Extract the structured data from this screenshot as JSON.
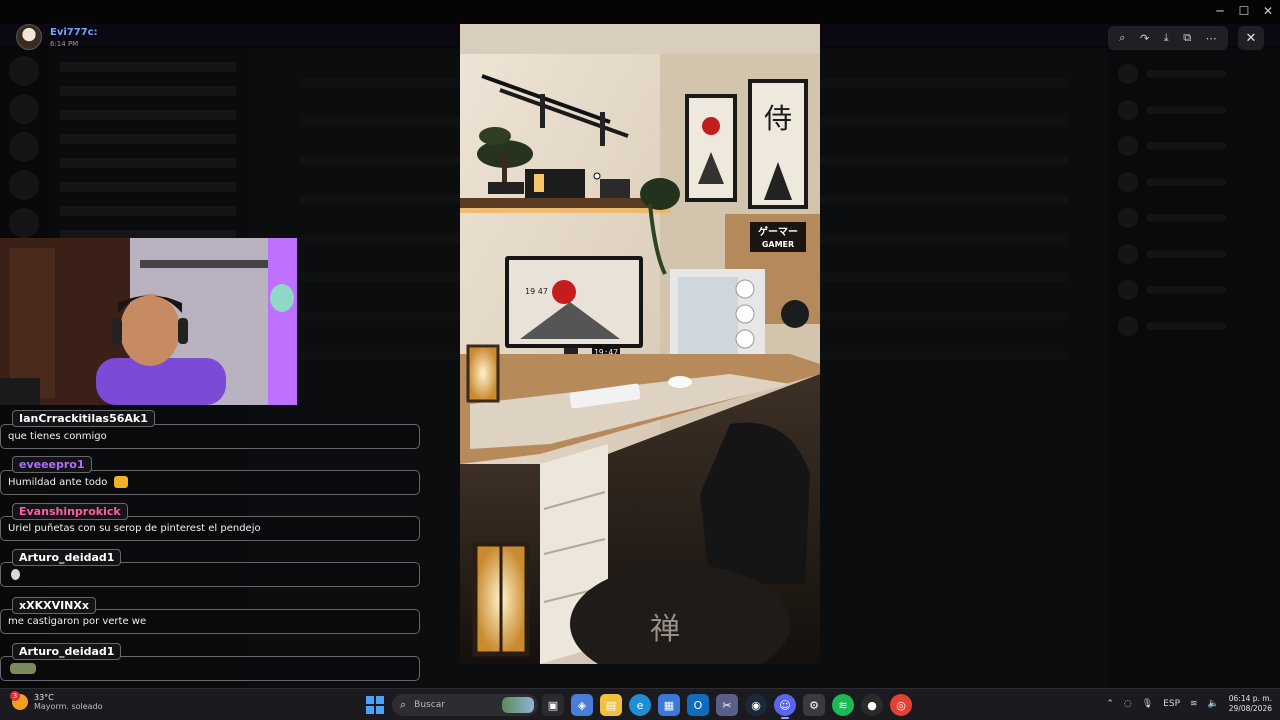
{
  "viewer": {
    "username": "Evi777c:",
    "time": "6:14 PM"
  },
  "chat": {
    "messages": [
      {
        "user": "IanCrrackitilas56Ak1",
        "user_color": "#ffffff",
        "text": "que tienes conmigo",
        "emoji": ""
      },
      {
        "user": "eveeepro1",
        "user_color": "#b26cff",
        "text": "Humildad ante todo",
        "emoji": "person-emoji"
      },
      {
        "user": "Evanshinprokick",
        "user_color": "#ff5fa2",
        "text": "Uriel puñetas con su serop de pinterest el pendejo",
        "emoji": ""
      },
      {
        "user": "Arturo_deidad1",
        "user_color": "#ffffff",
        "text": "",
        "emoji": "skull-emoji"
      },
      {
        "user": "xXKXVINXx",
        "user_color": "#ffffff",
        "text": "me castigaron por verte we",
        "emoji": ""
      },
      {
        "user": "Arturo_deidad1",
        "user_color": "#ffffff",
        "text": "",
        "emoji": "car-sticker"
      }
    ]
  },
  "photo": {
    "sign_text": "ゲーマー",
    "sign_sub": "GAMER",
    "poster_kanji": "侍",
    "monitor_year": "19 47",
    "clock_text": "19:47",
    "rug_kanji": "禅"
  },
  "taskbar": {
    "weather_badge": "3",
    "weather_temp": "33°C",
    "weather_desc": "Mayorm. soleado",
    "search_label": "Buscar",
    "lang": "ESP",
    "clock_time": "06:14 p. m.",
    "clock_date": "29/08/2026"
  },
  "colors": {
    "accent": "#6fa7ff",
    "overlay": "#0b0b0d",
    "taskbar": "#1b1b1f"
  }
}
